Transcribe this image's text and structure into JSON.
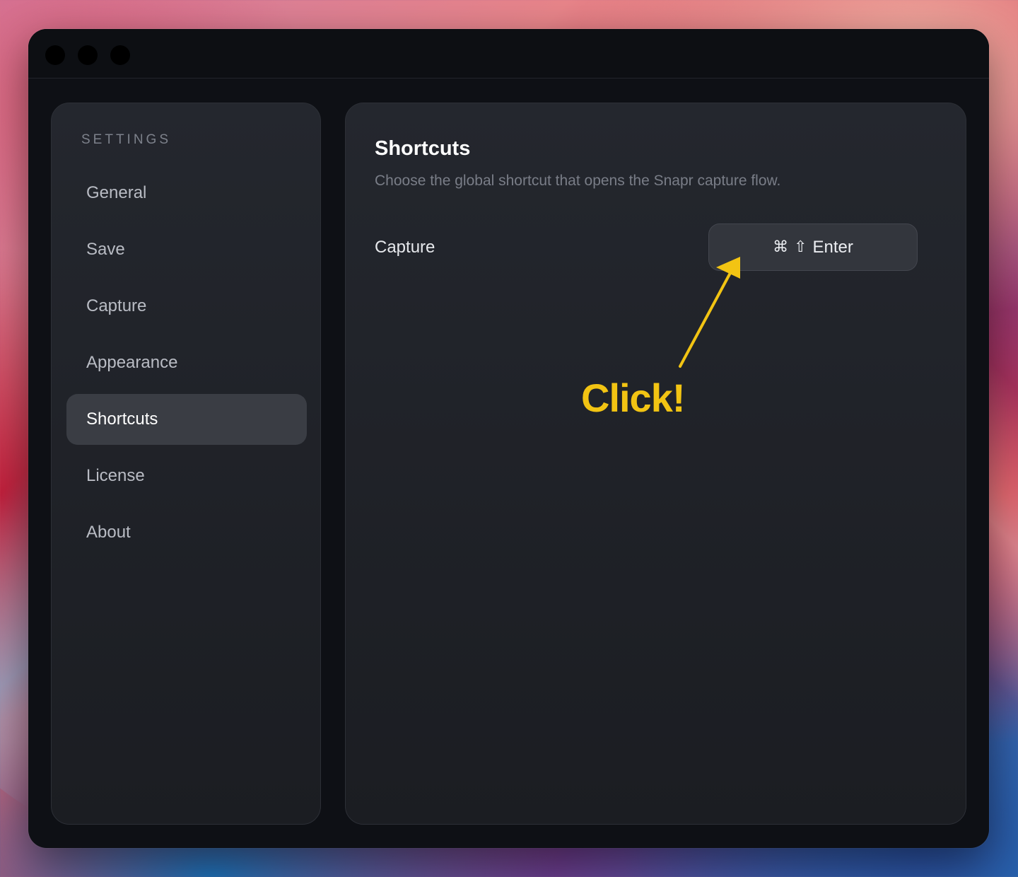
{
  "window": {
    "traffic_lights": [
      "close",
      "minimize",
      "zoom"
    ]
  },
  "sidebar": {
    "heading": "SETTINGS",
    "items": [
      {
        "label": "General",
        "active": false
      },
      {
        "label": "Save",
        "active": false
      },
      {
        "label": "Capture",
        "active": false
      },
      {
        "label": "Appearance",
        "active": false
      },
      {
        "label": "Shortcuts",
        "active": true
      },
      {
        "label": "License",
        "active": false
      },
      {
        "label": "About",
        "active": false
      }
    ]
  },
  "main": {
    "title": "Shortcuts",
    "subtitle": "Choose the global shortcut that opens the Snapr capture flow.",
    "rows": [
      {
        "label": "Capture",
        "shortcut": {
          "command_glyph": "⌘",
          "shift_glyph": "⇧",
          "key": "Enter"
        }
      }
    ]
  },
  "annotation": {
    "label": "Click!",
    "color": "#f2c413"
  },
  "colors": {
    "window_bg": "#0e1015",
    "panel_bg": "#24272e",
    "active_item_bg": "#3a3d44",
    "accent_annotation": "#f2c413"
  }
}
